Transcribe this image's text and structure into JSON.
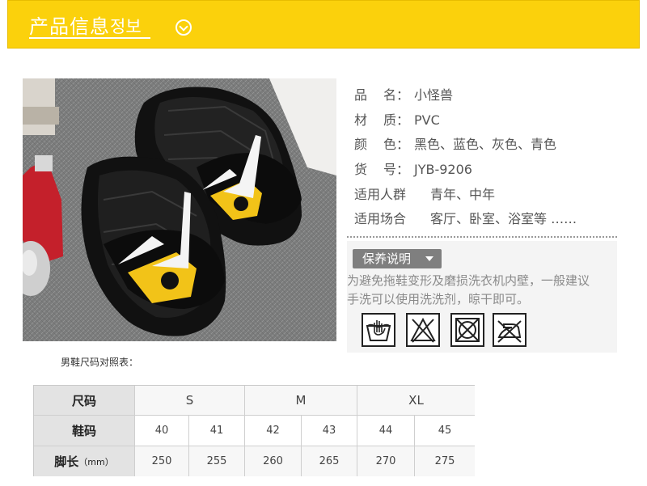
{
  "banner": {
    "title": "产品信息",
    "subtitle": "정보"
  },
  "product": {
    "rows": [
      {
        "label": "品名",
        "value": "小怪兽"
      },
      {
        "label": "材质",
        "value": "PVC"
      },
      {
        "label": "颜色",
        "value": "黑色、蓝色、灰色、青色"
      },
      {
        "label": "货号",
        "value": "JYB-9206"
      },
      {
        "label": "适用人群",
        "value": "青年、中年"
      },
      {
        "label": "适用场合",
        "value": "客厅、卧室、浴室等 ……"
      }
    ],
    "colon": "："
  },
  "care": {
    "title": "保养说明",
    "line1": "为避免拖鞋变形及磨损洗衣机内壁，一般建议",
    "line2": "手洗可以使用洗洗剂，晾干即可。",
    "icons": [
      "hand-wash-icon",
      "no-bleach-icon",
      "no-tumble-dry-icon",
      "no-iron-icon"
    ]
  },
  "size_chart": {
    "title": "男鞋尺码对照表：",
    "row_labels": {
      "size": "尺码",
      "shoe": "鞋码",
      "foot_main": "脚长",
      "foot_unit": "（mm）"
    },
    "sizes": [
      "S",
      "M",
      "XL"
    ],
    "shoe_codes": [
      "40",
      "41",
      "42",
      "43",
      "44",
      "45"
    ],
    "foot_lengths": [
      "250",
      "255",
      "260",
      "265",
      "270",
      "275"
    ]
  },
  "colors": {
    "banner": "#fbd10c",
    "accent_yellow": "#f2c318"
  }
}
